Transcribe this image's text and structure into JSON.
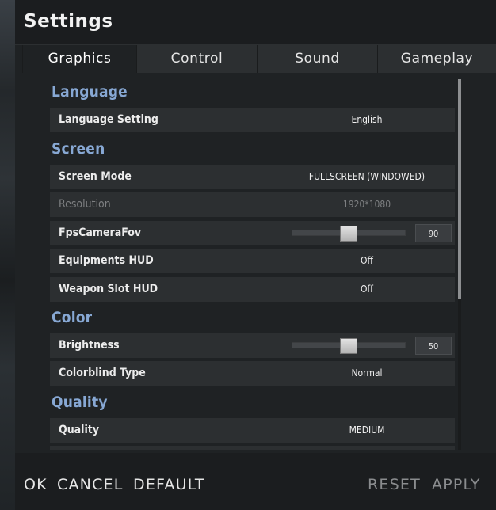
{
  "window": {
    "title": "Settings"
  },
  "tabs": [
    {
      "label": "Graphics",
      "active": true
    },
    {
      "label": "Control",
      "active": false
    },
    {
      "label": "Sound",
      "active": false
    },
    {
      "label": "Gameplay",
      "active": false
    }
  ],
  "sections": {
    "language": {
      "title": "Language",
      "language_setting": {
        "label": "Language Setting",
        "value": "English"
      }
    },
    "screen": {
      "title": "Screen",
      "screen_mode": {
        "label": "Screen Mode",
        "value": "FULLSCREEN (WINDOWED)"
      },
      "resolution": {
        "label": "Resolution",
        "value": "1920*1080",
        "disabled": true
      },
      "fps_camera_fov": {
        "label": "FpsCameraFov",
        "value": "90",
        "level": 0.5
      },
      "equipments_hud": {
        "label": "Equipments HUD",
        "value": "Off"
      },
      "weapon_slot_hud": {
        "label": "Weapon Slot HUD",
        "value": "Off"
      }
    },
    "color": {
      "title": "Color",
      "brightness": {
        "label": "Brightness",
        "value": "50",
        "level": 0.5
      },
      "colorblind_type": {
        "label": "Colorblind Type",
        "value": "Normal"
      }
    },
    "quality": {
      "title": "Quality",
      "quality": {
        "label": "Quality",
        "value": "MEDIUM"
      }
    }
  },
  "footer": {
    "ok": "OK",
    "cancel": "CANCEL",
    "default": "DEFAULT",
    "reset": "RESET",
    "apply": "APPLY"
  },
  "colors": {
    "section_title": "#87a8d4",
    "row_bg": "#2c2f31",
    "panel_bg": "#1f2224"
  }
}
